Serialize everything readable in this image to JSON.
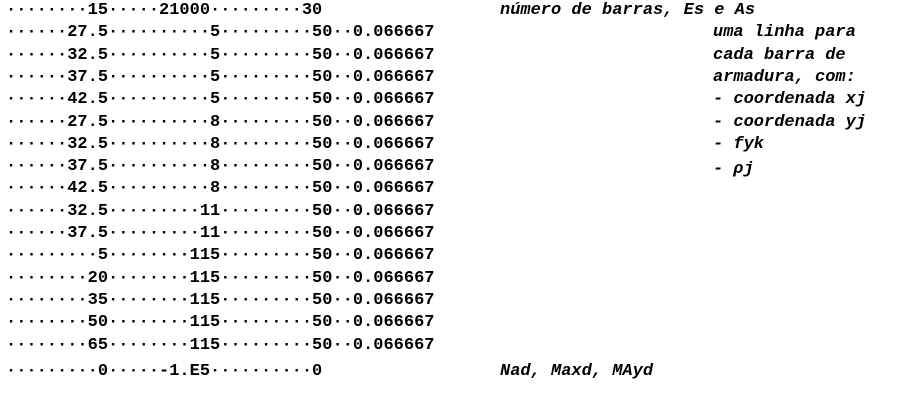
{
  "data_lines": [
    "········15·····21000·········30",
    "······27.5··········5·········50··0.066667",
    "······32.5··········5·········50··0.066667",
    "······37.5··········5·········50··0.066667",
    "······42.5··········5·········50··0.066667",
    "······27.5··········8·········50··0.066667",
    "······32.5··········8·········50··0.066667",
    "······37.5··········8·········50··0.066667",
    "······42.5··········8·········50··0.066667",
    "······32.5·········11·········50··0.066667",
    "······37.5·········11·········50··0.066667",
    "·········5········115·········50··0.066667",
    "········20········115·········50··0.066667",
    "········35········115·········50··0.066667",
    "········50········115·········50··0.066667",
    "········65········115·········50··0.066667",
    "·········0·····-1.E5··········0"
  ],
  "comments": {
    "header": "número de barras, Es e As",
    "bars": [
      "uma linha para",
      "cada barra de",
      "armadura, com:",
      "- coordenada xj",
      "- coordenada yj",
      "- fyk",
      "- ρj"
    ],
    "footer": "Nad, Maxd, MAyd"
  }
}
